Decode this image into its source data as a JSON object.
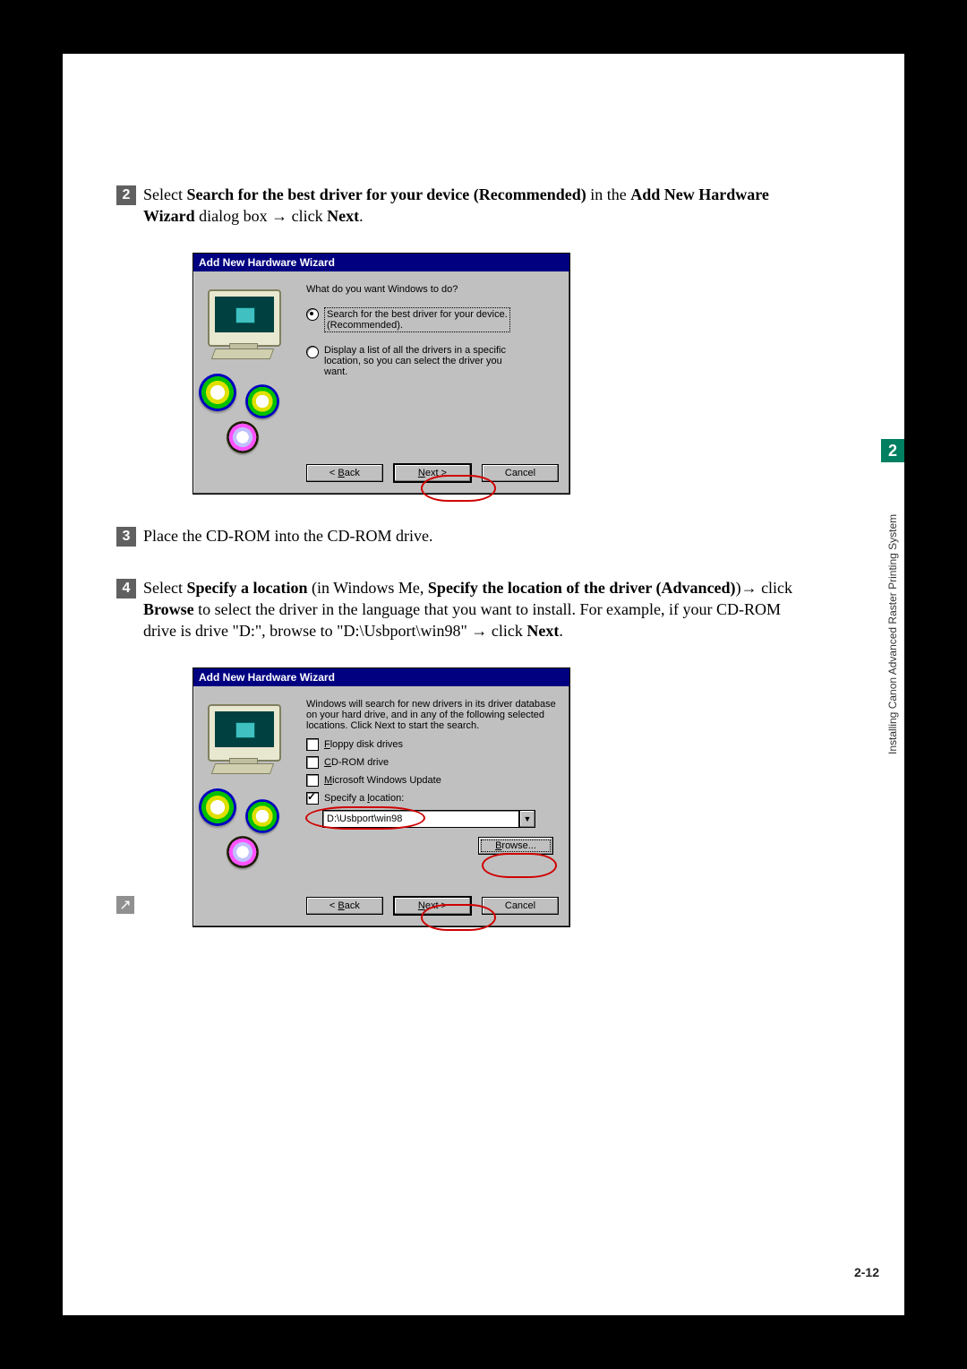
{
  "side": {
    "chapter_num": "2",
    "chapter_title": "Installing Canon Advanced Raster Printing System"
  },
  "page_number": "2-12",
  "steps": {
    "s2": {
      "num": "2",
      "t1": "Select ",
      "b1": "Search for the best driver for your device (Recommended)",
      "t2": " in the ",
      "b2": "Add New Hardware Wizard",
      "t3": " dialog box ",
      "arrow": "→",
      "t4": " click ",
      "b3": "Next",
      "t5": "."
    },
    "s3": {
      "num": "3",
      "text": "Place the CD-ROM into the CD-ROM drive."
    },
    "s4": {
      "num": "4",
      "t1": "Select ",
      "b1": "Specify a location",
      "t2": " (in Windows Me, ",
      "b2": "Specify the location of the driver (Advanced)",
      "t3": ")",
      "arrow1": "→",
      "t4": " click ",
      "b3": "Browse",
      "t5": " to select the driver in the language that you want to install. For example, if your CD-ROM drive is drive \"D:\", browse to \"D:\\Usbport\\win98\" ",
      "arrow2": "→",
      "t6": " click ",
      "b4": "Next",
      "t7": "."
    }
  },
  "dialog1": {
    "title": "Add New Hardware Wizard",
    "prompt": "What do you want Windows to do?",
    "opt1a": "Search for the best driver for your device.",
    "opt1b": "(Recommended).",
    "opt2": "Display a list of all the drivers in a specific location, so you can select the driver you want.",
    "back_u": "B",
    "back_rest": "ack",
    "next_u": "N",
    "next_rest": "ext >",
    "cancel": "Cancel"
  },
  "dialog2": {
    "title": "Add New Hardware Wizard",
    "intro": "Windows will search for new drivers in its driver database on your hard drive, and in any of the following selected locations. Click Next to start the search.",
    "c1_u": "F",
    "c1_rest": "loppy disk drives",
    "c2_u": "C",
    "c2_rest": "D-ROM drive",
    "c3_u": "M",
    "c3_rest": "icrosoft Windows Update",
    "c4_pre": "Specify a ",
    "c4_u": "l",
    "c4_rest": "ocation:",
    "path": "D:\\Usbport\\win98",
    "browse_u": "B",
    "browse_pre": "",
    "browse_rest": "rowse...",
    "back_u": "B",
    "back_rest": "ack",
    "next_u": "N",
    "next_rest": "ext >",
    "cancel": "Cancel"
  }
}
